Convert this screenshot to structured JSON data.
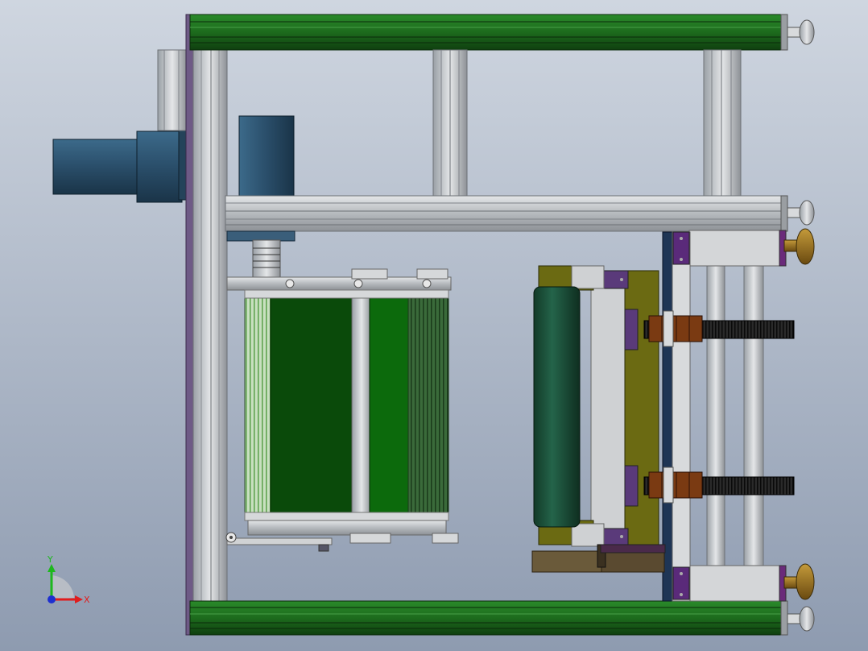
{
  "viewport": {
    "background_top": "#cfd6e0",
    "background_bottom": "#8e9bb0"
  },
  "colors": {
    "frame_green": "#1d6b1d",
    "frame_green_dark": "#0f3f0f",
    "aluminum": "#c9ccd0",
    "aluminum_dark": "#8d9196",
    "purple": "#5a3a7a",
    "motor_blue": "#2f5572",
    "roller_dark_green": "#1b4d36",
    "olive": "#6b6a12",
    "brown_nut": "#7a3a12",
    "bronze": "#8a6a1a",
    "navy": "#1e3555"
  },
  "triad": {
    "y_label": "Y",
    "x_label": "X",
    "y_color": "#1db81d",
    "x_color": "#e01d1d",
    "z_color": "#1d2fd0"
  }
}
